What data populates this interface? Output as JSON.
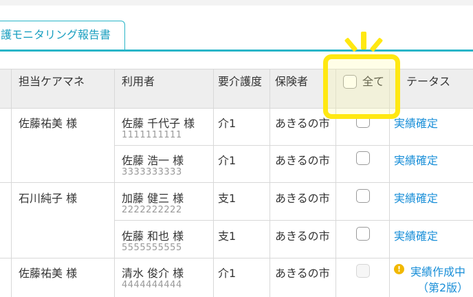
{
  "tab": {
    "label": "護モニタリング報告書"
  },
  "table": {
    "headers": {
      "care_manager": "担当ケアマネ",
      "user": "利用者",
      "care_level": "要介護度",
      "insurer": "保険者",
      "select_all": "全て",
      "status": "テータス"
    },
    "rows": [
      {
        "care_manager": "佐藤祐美 様",
        "user_name": "佐藤 千代子 様",
        "user_id": "1111111111",
        "care_level": "介1",
        "insurer": "あきるの市",
        "status": "実績確定"
      },
      {
        "care_manager": "",
        "user_name": "佐藤 浩一 様",
        "user_id": "3333333333",
        "care_level": "介1",
        "insurer": "あきるの市",
        "status": "実績確定"
      },
      {
        "care_manager": "石川純子 様",
        "user_name": "加藤 健三 様",
        "user_id": "2222222222",
        "care_level": "支1",
        "insurer": "あきるの市",
        "status": "実績確定"
      },
      {
        "care_manager": "",
        "user_name": "佐藤 和也 様",
        "user_id": "5555555555",
        "care_level": "支1",
        "insurer": "あきるの市",
        "status": "実績確定"
      },
      {
        "care_manager": "佐藤祐美 様",
        "user_name": "清水 俊介 様",
        "user_id": "4444444444",
        "care_level": "介1",
        "insurer": "あきるの市",
        "status": "実績作成中",
        "status_line2": "（第2版）",
        "warning_icon": "!"
      }
    ]
  },
  "colors": {
    "accent": "#29b5c8",
    "link": "#1a8fd8",
    "highlight": "#ffe812",
    "warning": "#f1b800"
  }
}
